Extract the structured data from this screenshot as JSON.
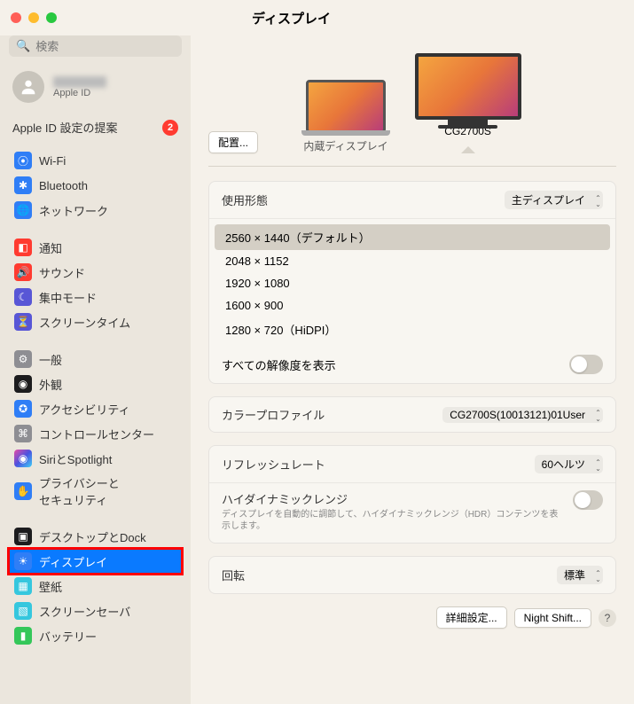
{
  "title": "ディスプレイ",
  "search": {
    "placeholder": "検索"
  },
  "account": {
    "sub": "Apple ID"
  },
  "suggestion": {
    "label": "Apple ID 設定の提案",
    "count": "2"
  },
  "sidebar": {
    "group1": [
      {
        "label": "Wi-Fi"
      },
      {
        "label": "Bluetooth"
      },
      {
        "label": "ネットワーク"
      }
    ],
    "group2": [
      {
        "label": "通知"
      },
      {
        "label": "サウンド"
      },
      {
        "label": "集中モード"
      },
      {
        "label": "スクリーンタイム"
      }
    ],
    "group3": [
      {
        "label": "一般"
      },
      {
        "label": "外観"
      },
      {
        "label": "アクセシビリティ"
      },
      {
        "label": "コントロールセンター"
      },
      {
        "label": "SiriとSpotlight"
      },
      {
        "label": "プライバシーと\nセキュリティ"
      }
    ],
    "group4": [
      {
        "label": "デスクトップとDock"
      },
      {
        "label": "ディスプレイ"
      },
      {
        "label": "壁紙"
      },
      {
        "label": "スクリーンセーバ"
      },
      {
        "label": "バッテリー"
      }
    ]
  },
  "arrange_btn": "配置...",
  "displays": {
    "internal": "内蔵ディスプレイ",
    "external": "CG2700S"
  },
  "usage": {
    "label": "使用形態",
    "value": "主ディスプレイ"
  },
  "resolutions": [
    "2560 × 1440（デフォルト）",
    "2048 × 1152",
    "1920 × 1080",
    "1600 × 900",
    "1280 × 720（HiDPI）"
  ],
  "show_all": "すべての解像度を表示",
  "color_profile": {
    "label": "カラープロファイル",
    "value": "CG2700S(10013121)01User"
  },
  "refresh": {
    "label": "リフレッシュレート",
    "value": "60ヘルツ"
  },
  "hdr": {
    "title": "ハイダイナミックレンジ",
    "desc": "ディスプレイを自動的に調節して、ハイダイナミックレンジ（HDR）コンテンツを表示します。"
  },
  "rotation": {
    "label": "回転",
    "value": "標準"
  },
  "buttons": {
    "advanced": "詳細設定...",
    "nightshift": "Night Shift...",
    "help": "?"
  }
}
